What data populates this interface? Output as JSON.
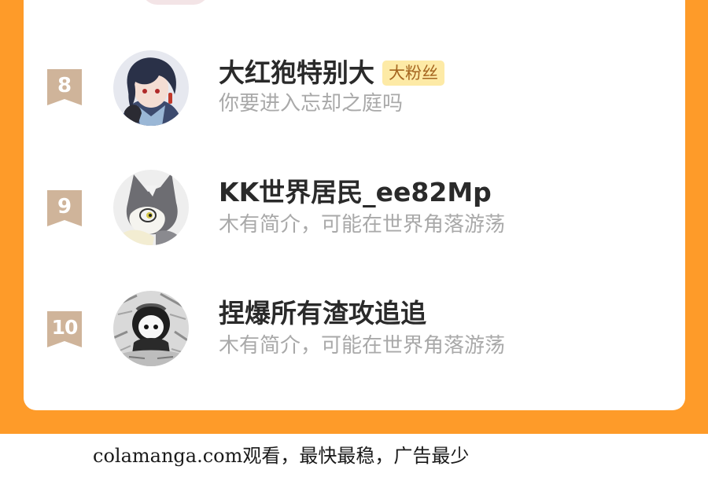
{
  "colors": {
    "frame": "#fe9b29",
    "card": "#ffffff",
    "rank_badge": "#cfb49a",
    "name": "#2a2a2a",
    "bio": "#a9a9a9",
    "fan_badge_bg": "#fdeaa6",
    "fan_badge_text": "#a5651f"
  },
  "ranking": {
    "items": [
      {
        "rank": "8",
        "name": "大红狍特别大",
        "badge": "大粉丝",
        "bio": "你要进入忘却之庭吗",
        "avatar_icon": "anime-boy-avatar"
      },
      {
        "rank": "9",
        "name": "KK世界居民_ee82Mp",
        "badge": "",
        "bio": "木有简介，可能在世界角落游荡",
        "avatar_icon": "cartoon-wolf-avatar"
      },
      {
        "rank": "10",
        "name": "捏爆所有渣攻追追",
        "badge": "",
        "bio": "木有简介，可能在世界角落游荡",
        "avatar_icon": "chibi-sketch-avatar"
      }
    ]
  },
  "footer": {
    "watermark": "colamanga.com观看，最快最稳，广告最少"
  }
}
